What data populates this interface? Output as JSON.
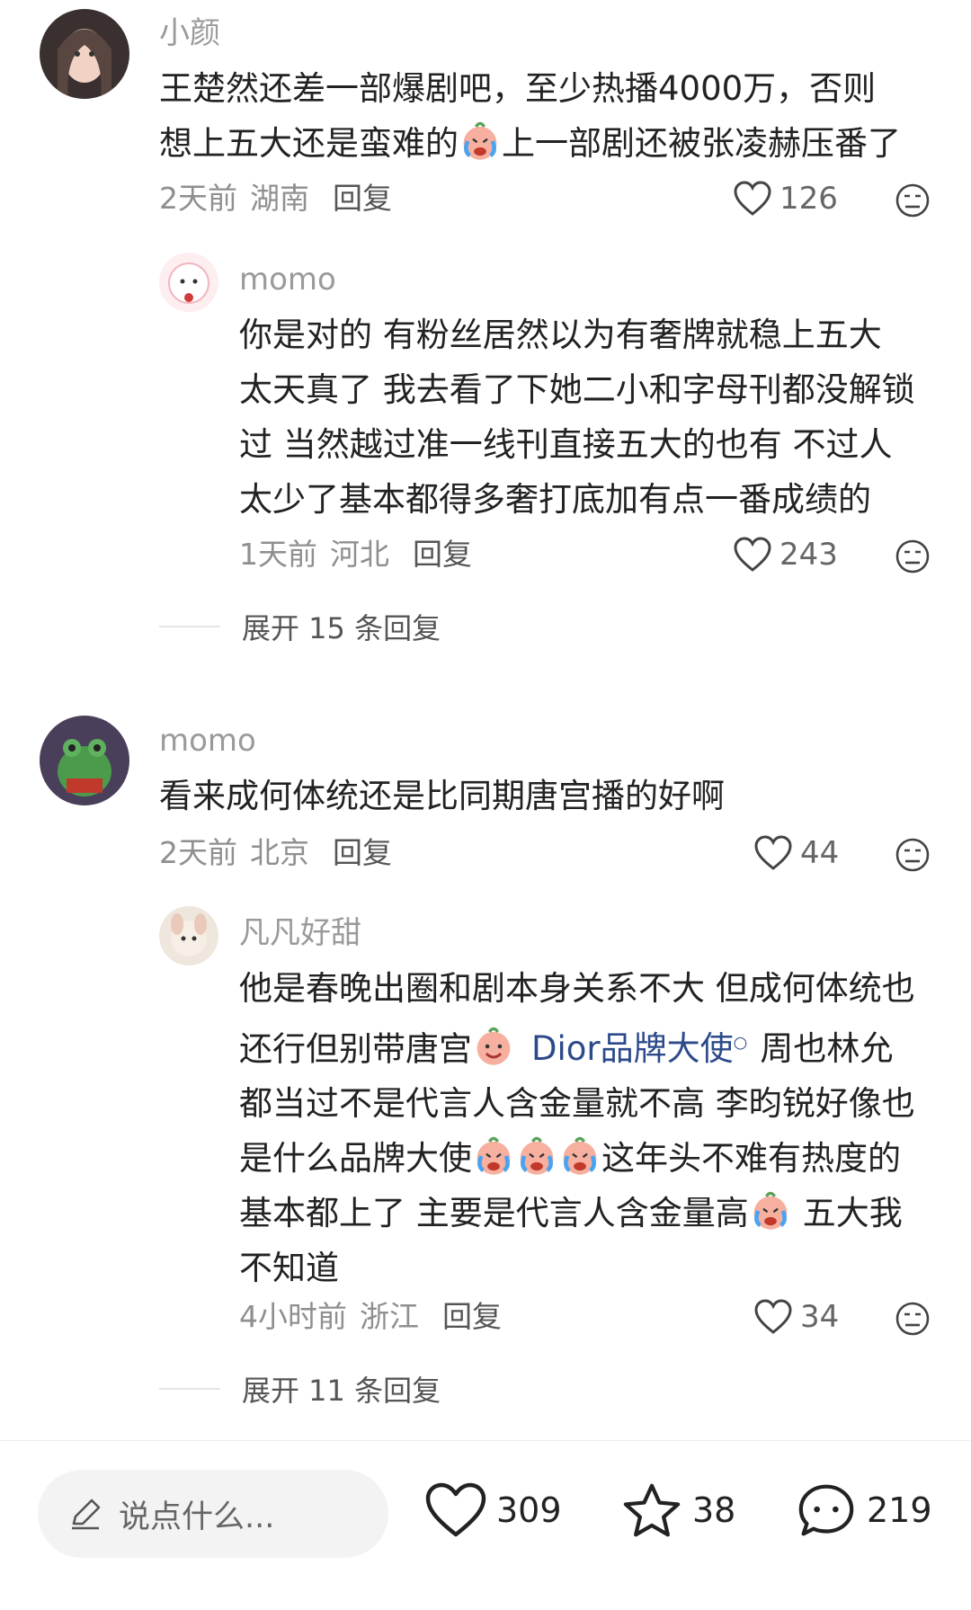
{
  "comments": [
    {
      "username": "小颜",
      "lines": [
        "王楚然还差一部爆剧吧，至少热播4000万，否则",
        "想上五大还是蛮难的",
        "上一部剧还被张凌赫压番了"
      ],
      "time": "2天前",
      "location": "湖南",
      "reply_label": "回复",
      "likes": "126"
    },
    {
      "username": "momo",
      "lines": [
        "你是对的 有粉丝居然以为有奢牌就稳上五大",
        "太天真了 我去看了下她二小和字母刊都没解锁",
        "过 当然越过准一线刊直接五大的也有 不过人",
        "太少了基本都得多奢打底加有点一番成绩的"
      ],
      "time": "1天前",
      "location": "河北",
      "reply_label": "回复",
      "likes": "243"
    },
    {
      "username": "momo",
      "lines": [
        "看来成何体统还是比同期唐宫播的好啊"
      ],
      "time": "2天前",
      "location": "北京",
      "reply_label": "回复",
      "likes": "44"
    },
    {
      "username": "凡凡好甜",
      "lines": [
        "他是春晚出圈和剧本身关系不大 但成何体统也",
        "还行但别带唐宫",
        "Dior品牌大使",
        "周也林允",
        "都当过不是代言人含金量就不高 李昀锐好像也",
        "是什么品牌大使",
        "这年头不难有热度的",
        "基本都上了 主要是代言人含金量高",
        "五大我",
        "不知道"
      ],
      "time": "4小时前",
      "location": "浙江",
      "reply_label": "回复",
      "likes": "34"
    }
  ],
  "expand_1": "展开 15 条回复",
  "expand_2": "展开 11 条回复",
  "bottom": {
    "input_placeholder": "说点什么...",
    "likes": "309",
    "favorites": "38",
    "comments": "219"
  },
  "colors": {
    "link": "#2c4a8a",
    "meta": "#8f8f8f"
  },
  "icons": [
    "heart-icon",
    "dislike-face-icon",
    "pencil-icon",
    "star-icon",
    "chat-bubble-icon",
    "crying-emoji",
    "smile-emoji"
  ]
}
